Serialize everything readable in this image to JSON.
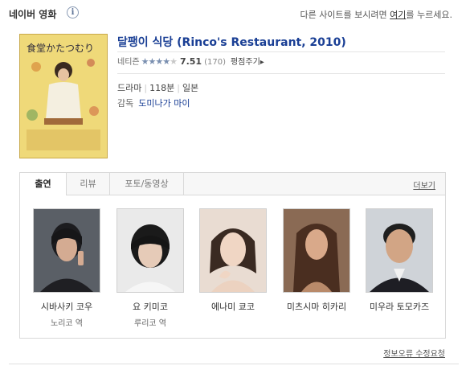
{
  "header": {
    "brand": "네이버 영화",
    "info_icon": "info-icon",
    "notice_before": "다른 사이트를 보시려면 ",
    "notice_link": "여기",
    "notice_after": "를 누르세요."
  },
  "movie": {
    "title": "달팽이 식당 (Rinco's Restaurant, 2010)",
    "poster_title_text": "食堂かたつむり",
    "rating_label": "네티즌",
    "stars_filled": "★★★★",
    "stars_empty": "★",
    "star_rating_fraction": 0.75,
    "score": "7.51",
    "count": "(170)",
    "rate_link": "평점주기▸",
    "genre": "드라마",
    "runtime": "118분",
    "country": "일본",
    "director_label": "감독",
    "director": "도미나가 마이"
  },
  "tabs": [
    {
      "label": "출연",
      "active": true
    },
    {
      "label": "리뷰",
      "active": false
    },
    {
      "label": "포토/동영상",
      "active": false
    }
  ],
  "more_link": "더보기",
  "cast": [
    {
      "name": "시바사키 코우",
      "role": "노리코 역"
    },
    {
      "name": "요 키미코",
      "role": "루리코 역"
    },
    {
      "name": "에나미 쿄코",
      "role": ""
    },
    {
      "name": "미츠시마 히카리",
      "role": ""
    },
    {
      "name": "미우라 토모카즈",
      "role": ""
    }
  ],
  "footer": {
    "report_link": "정보오류 수정요청"
  },
  "colors": {
    "link_blue": "#1a3f95",
    "poster_yellow": "#e8c95a"
  }
}
